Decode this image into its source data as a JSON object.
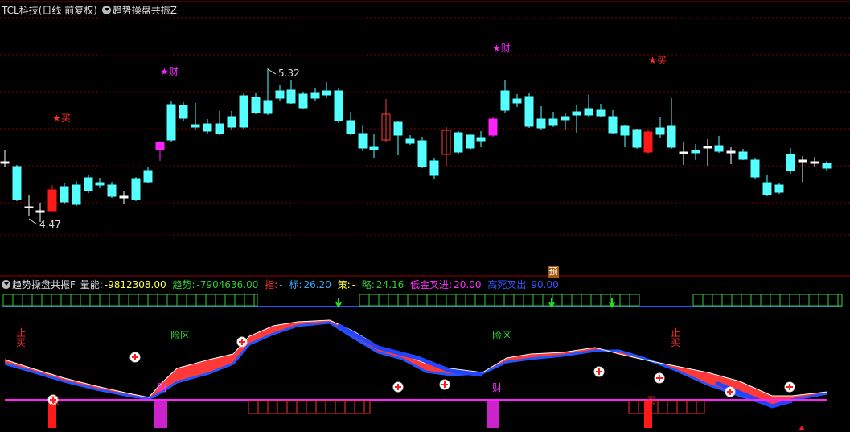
{
  "header": {
    "stock": "TCL科技(日线 前复权)",
    "indicator": "趋势操盘共振Z"
  },
  "main_chart": {
    "high_label": "5.32",
    "low_label": "4.47",
    "markers": [
      {
        "text": "★买",
        "color": "#ff2a2a"
      },
      {
        "text": "★财",
        "color": "#ff22ff"
      },
      {
        "text": "★财",
        "color": "#ff22ff"
      },
      {
        "text": "★买",
        "color": "#ff2a2a"
      }
    ],
    "badge": "预"
  },
  "indicator_panel": {
    "name": "趋势操盘共振F",
    "values": [
      {
        "label": "量能:",
        "value": "-9812308.00",
        "color": "#ffff44"
      },
      {
        "label": "趋势:",
        "value": "-7904636.00",
        "color": "#33cc33"
      },
      {
        "label": "指:",
        "value": "-",
        "color": "#ff3333"
      },
      {
        "label": "标:",
        "value": "26.20",
        "color": "#33aaff"
      },
      {
        "label": "策:",
        "value": "-",
        "color": "#ffff44"
      },
      {
        "label": "略:",
        "value": "24.16",
        "color": "#33cc33"
      },
      {
        "label": "低金叉进:",
        "value": "20.00",
        "color": "#ff33ff"
      },
      {
        "label": "高死叉出:",
        "value": "90.00",
        "color": "#3355ff"
      }
    ],
    "labels": [
      {
        "text": "止\n买",
        "color": "#ff2a2a"
      },
      {
        "text": "险区",
        "color": "#33dd33"
      },
      {
        "text": "险区",
        "color": "#33dd33"
      },
      {
        "text": "止\n买",
        "color": "#ff2a2a"
      },
      {
        "text": "买",
        "color": "#ff2a2a"
      },
      {
        "text": "买",
        "color": "#ff2a2a"
      },
      {
        "text": "财",
        "color": "#ff33ff"
      },
      {
        "text": "财",
        "color": "#ff33ff"
      }
    ]
  },
  "colors": {
    "up": "#ff3b3b",
    "down": "#54ffff",
    "grid": "#7a0000",
    "magenta": "#ff22ff",
    "blue": "#2255ff",
    "green": "#33cc33"
  }
}
